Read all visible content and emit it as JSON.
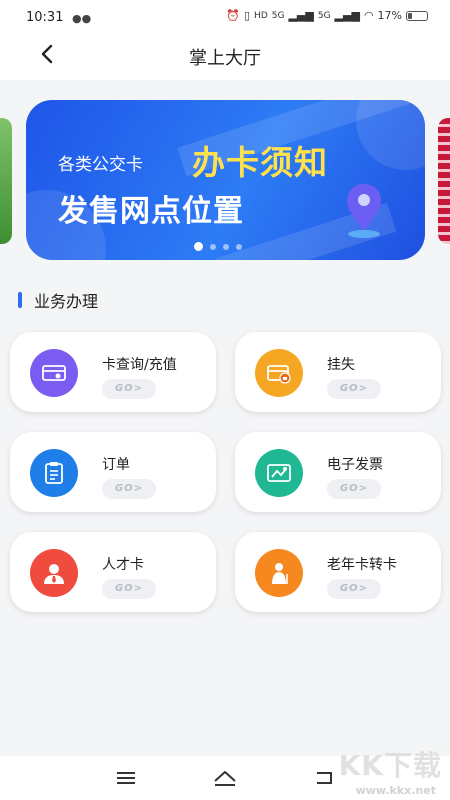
{
  "status_bar": {
    "time": "10:31",
    "chat_icon": "wechat-icon",
    "battery": "17%",
    "signal_labels": [
      "HD",
      "5G",
      "5G"
    ]
  },
  "nav": {
    "title": "掌上大厅",
    "back_icon": "back-arrow-icon"
  },
  "banner": {
    "small_text": "各类公交卡",
    "big_text": "办卡须知",
    "sub_text": "发售网点位置",
    "pages": 4,
    "active_page": 1,
    "colors": {
      "bg": "#2463ee",
      "headline": "#ffe14d"
    }
  },
  "section": {
    "title": "业务办理",
    "accent": "#2f6df0"
  },
  "services": [
    {
      "label": "卡查询/充值",
      "go": "GO>",
      "icon": "card-recharge-icon",
      "color": "#7b5cf0"
    },
    {
      "label": "挂失",
      "go": "GO>",
      "icon": "card-lock-icon",
      "color": "#f5a623"
    },
    {
      "label": "订单",
      "go": "GO>",
      "icon": "order-clipboard-icon",
      "color": "#1f7ee8"
    },
    {
      "label": "电子发票",
      "go": "GO>",
      "icon": "e-invoice-icon",
      "color": "#1fb893"
    },
    {
      "label": "人才卡",
      "go": "GO>",
      "icon": "talent-card-icon",
      "color": "#ef4b3e"
    },
    {
      "label": "老年卡转卡",
      "go": "GO>",
      "icon": "elder-card-icon",
      "color": "#f5881f"
    }
  ],
  "system_nav": [
    "menu-icon",
    "home-icon",
    "back-icon"
  ],
  "watermark": {
    "main": "KK下载",
    "url": "www.kkx.net"
  }
}
